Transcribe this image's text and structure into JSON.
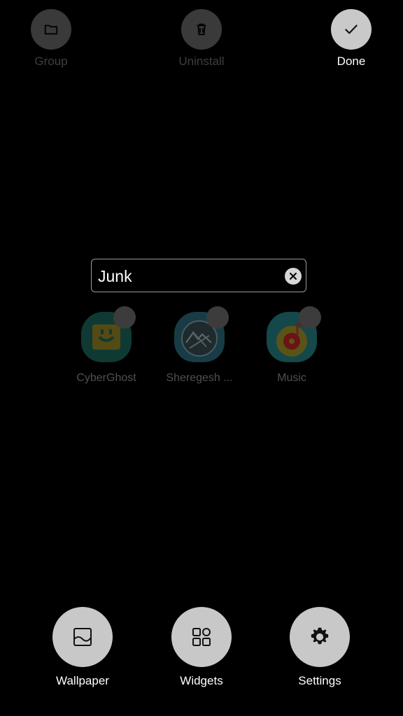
{
  "top_bar": {
    "group_label": "Group",
    "uninstall_label": "Uninstall",
    "done_label": "Done"
  },
  "folder": {
    "name": "Junk"
  },
  "apps": [
    {
      "label": "CyberGhost",
      "icon": "cyberghost-app-icon"
    },
    {
      "label": "Sheregesh ...",
      "icon": "sheregesh-app-icon"
    },
    {
      "label": "Music",
      "icon": "music-app-icon"
    }
  ],
  "bottom_bar": {
    "wallpaper_label": "Wallpaper",
    "widgets_label": "Widgets",
    "settings_label": "Settings"
  },
  "colors": {
    "background": "#000000",
    "button_light": "#c8c8c8",
    "button_dim": "#3a3a3a",
    "text_primary": "#ffffff",
    "text_dim": "#3f3f3f"
  }
}
